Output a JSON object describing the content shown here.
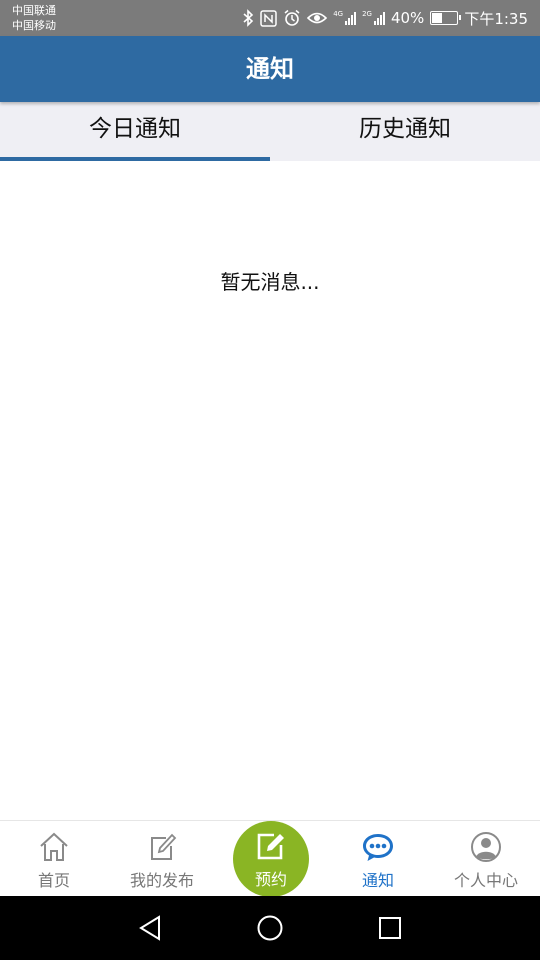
{
  "status_bar": {
    "carrier1": "中国联通",
    "carrier2": "中国移动",
    "network1": "4G",
    "network2": "2G",
    "battery_text": "40%",
    "battery_level": 0.4,
    "time": "下午1:35",
    "icons": [
      "bluetooth-icon",
      "nfc-icon",
      "alarm-icon",
      "eye-icon",
      "signal-icon",
      "battery-icon"
    ]
  },
  "header": {
    "title": "通知"
  },
  "tabs": [
    {
      "label": "今日通知",
      "active": true
    },
    {
      "label": "历史通知",
      "active": false
    }
  ],
  "content": {
    "empty_message": "暂无消息..."
  },
  "bottom_nav": {
    "items": [
      {
        "label": "首页",
        "icon": "home-icon",
        "active": false
      },
      {
        "label": "我的发布",
        "icon": "edit-icon",
        "active": false
      },
      {
        "label": "预约",
        "icon": "pencil-square-icon",
        "active": false
      },
      {
        "label": "通知",
        "icon": "chat-bubble-icon",
        "active": true
      },
      {
        "label": "个人中心",
        "icon": "user-icon",
        "active": false
      }
    ],
    "active_color": "#1f72c8",
    "center_color": "#8ab524"
  },
  "system_nav": {
    "icons": [
      "back-icon",
      "home-circle-icon",
      "recent-apps-icon"
    ]
  },
  "colors": {
    "header": "#2e6aa2",
    "tab_bg": "#efeff4",
    "tab_indicator": "#2e6aa2"
  }
}
